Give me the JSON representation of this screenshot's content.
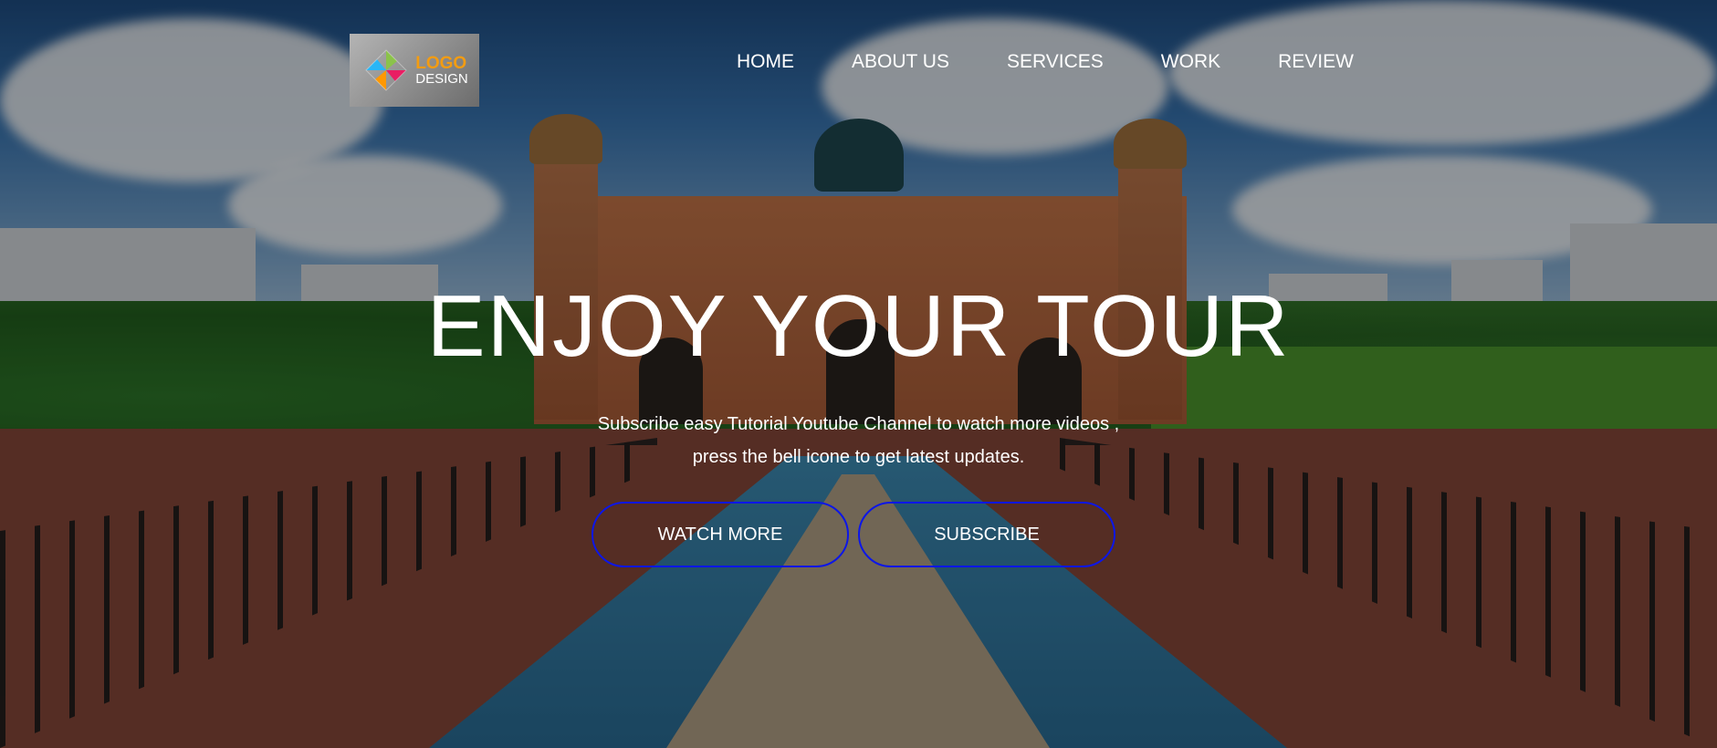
{
  "logo": {
    "line1": "LOGO",
    "line2": "DESIGN"
  },
  "nav": [
    {
      "label": "HOME"
    },
    {
      "label": "ABOUT US"
    },
    {
      "label": "SERVICES"
    },
    {
      "label": "WORK"
    },
    {
      "label": "REVIEW"
    }
  ],
  "hero": {
    "title": "ENJOY YOUR TOUR",
    "subtitle_line1": "Subscribe easy Tutorial Youtube Channel to watch more videos ,",
    "subtitle_line2": "press the bell icone to get latest updates."
  },
  "buttons": {
    "watch_more": "WATCH MORE",
    "subscribe": "SUBSCRIBE"
  },
  "colors": {
    "button_border": "#0c16e8",
    "text": "#ffffff",
    "logo_accent": "#f39c12"
  }
}
